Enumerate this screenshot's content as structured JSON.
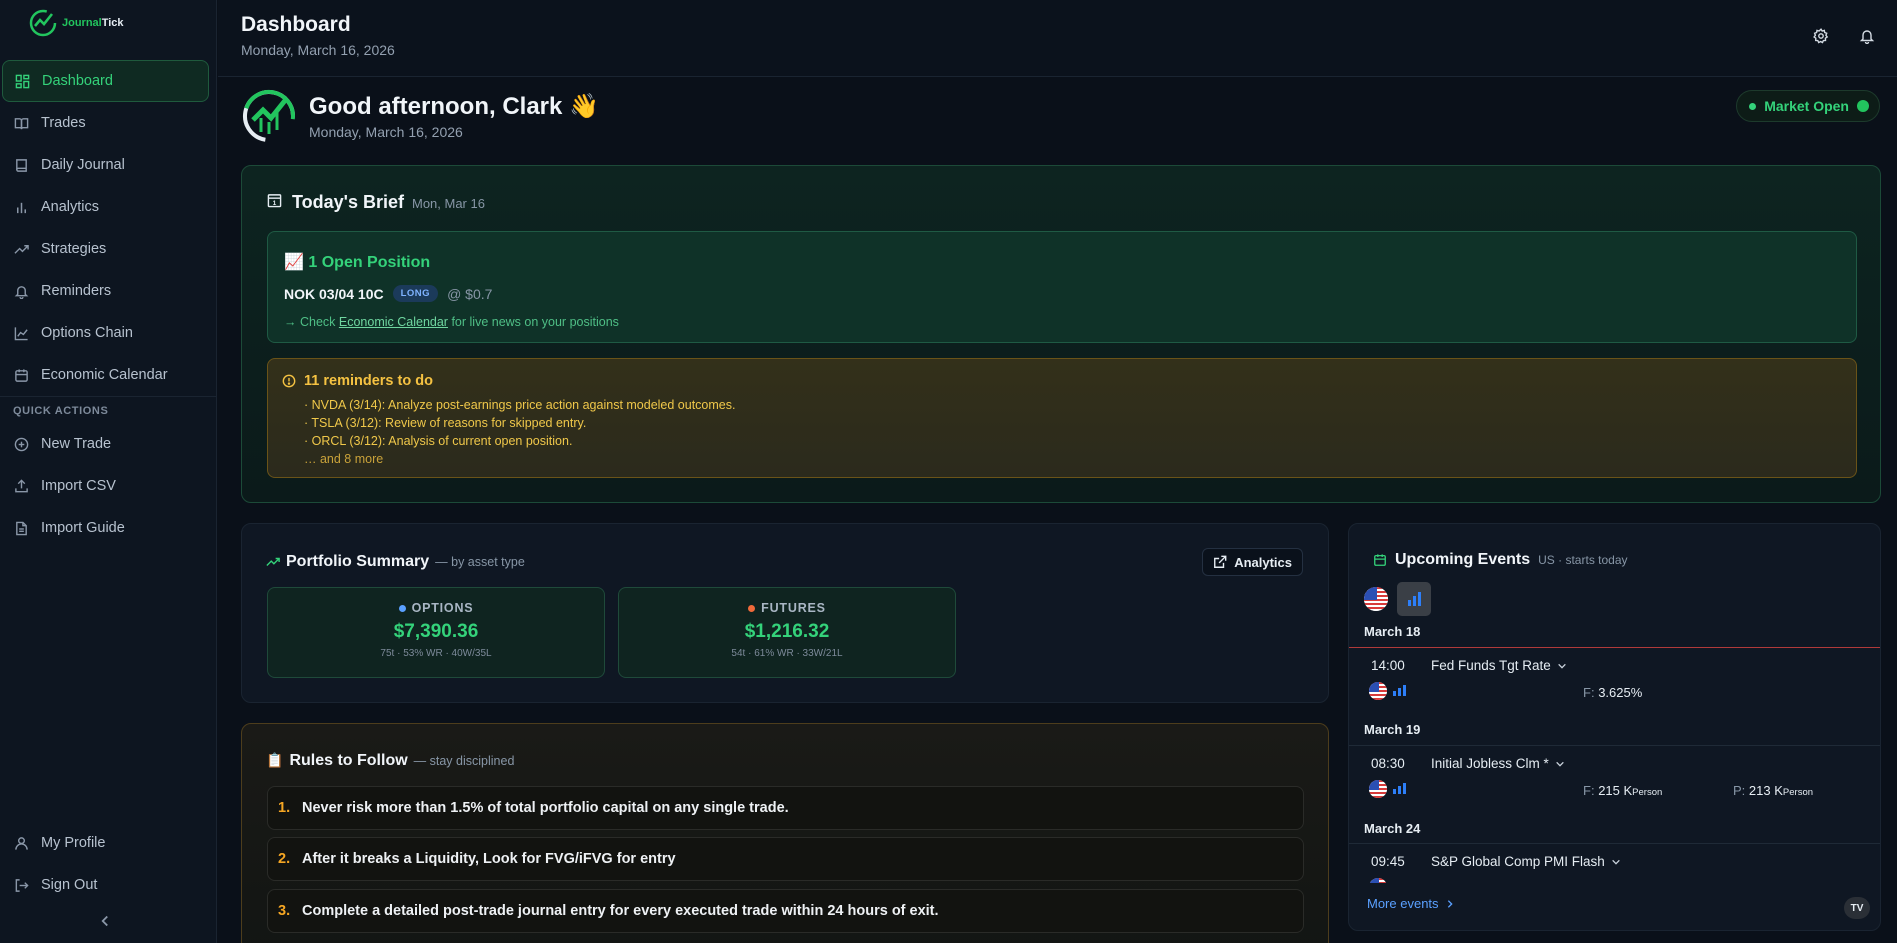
{
  "app": {
    "logo_prefix": "Journal",
    "logo_suffix": "Tick"
  },
  "sidebar": {
    "items": [
      {
        "label": "Dashboard",
        "icon": "dashboard-icon",
        "active": true
      },
      {
        "label": "Trades",
        "icon": "book-open-icon"
      },
      {
        "label": "Daily Journal",
        "icon": "book-icon"
      },
      {
        "label": "Analytics",
        "icon": "bar-chart-icon"
      },
      {
        "label": "Strategies",
        "icon": "trending-up-icon"
      },
      {
        "label": "Reminders",
        "icon": "bell-icon"
      },
      {
        "label": "Options Chain",
        "icon": "line-chart-icon"
      },
      {
        "label": "Economic Calendar",
        "icon": "calendar-icon"
      }
    ],
    "quick_actions_label": "QUICK ACTIONS",
    "quick_actions": [
      {
        "label": "New Trade",
        "icon": "plus-circle-icon"
      },
      {
        "label": "Import CSV",
        "icon": "upload-icon"
      },
      {
        "label": "Import Guide",
        "icon": "file-text-icon"
      }
    ],
    "bottom": [
      {
        "label": "My Profile",
        "icon": "user-icon"
      },
      {
        "label": "Sign Out",
        "icon": "sign-out-icon"
      }
    ]
  },
  "header": {
    "title": "Dashboard",
    "date": "Monday, March 16, 2026"
  },
  "greeting": {
    "title": "Good afternoon, Clark 👋",
    "date": "Monday, March 16, 2026",
    "market_status": "Market Open"
  },
  "brief": {
    "title": "Today's Brief",
    "date": "Mon, Mar 16",
    "open_positions": {
      "title": "1 Open Position",
      "symbol": "NOK 03/04 10C",
      "side": "LONG",
      "price": "@ $0.7",
      "hint_prefix": "→ Check ",
      "hint_link": "Economic Calendar",
      "hint_suffix": " for live news on your positions"
    },
    "reminders": {
      "title": "11 reminders to do",
      "items": [
        "· NVDA (3/14): Analyze post-earnings price action against modeled outcomes.",
        "· TSLA (3/12): Review of reasons for skipped entry.",
        "· ORCL (3/12): Analysis of current open position."
      ],
      "more": "… and 8 more"
    }
  },
  "portfolio": {
    "title": "Portfolio Summary",
    "subtitle": "— by asset type",
    "analytics_button": "Analytics",
    "assets": [
      {
        "label": "OPTIONS",
        "value": "$7,390.36",
        "stats": "75t · 53% WR · 40W/35L",
        "dot_color": "#5aa0ff"
      },
      {
        "label": "FUTURES",
        "value": "$1,216.32",
        "stats": "54t · 61% WR · 33W/21L",
        "dot_color": "#f06a3a"
      }
    ]
  },
  "rules": {
    "title": "Rules to Follow",
    "subtitle": "— stay disciplined",
    "items": [
      {
        "num": "1.",
        "text": "Never risk more than 1.5% of total portfolio capital on any single trade."
      },
      {
        "num": "2.",
        "text": "After it breaks a Liquidity, Look for FVG/iFVG for entry"
      },
      {
        "num": "3.",
        "text": "Complete a detailed post-trade journal entry for every executed trade within 24 hours of exit."
      }
    ]
  },
  "events": {
    "title": "Upcoming Events",
    "subtitle": "US · starts today",
    "groups": [
      {
        "date": "March 18",
        "time": "14:00",
        "name": "Fed Funds Tgt Rate",
        "forecast_label": "F:",
        "forecast": "3.625%",
        "prev_label": "",
        "prev": "",
        "unit": ""
      },
      {
        "date": "March 19",
        "time": "08:30",
        "name": "Initial Jobless Clm *",
        "forecast_label": "F:",
        "forecast": "215 K",
        "unit": "Person",
        "prev_label": "P:",
        "prev": "213 K",
        "prev_unit": "Person"
      },
      {
        "date": "March 24",
        "time": "09:45",
        "name": "S&P Global Comp PMI Flash"
      }
    ],
    "more": "More events",
    "tv_logo": "TV"
  },
  "colors": {
    "accent_green": "#34d27a",
    "warning_yellow": "#f5c242",
    "link_blue": "#5aa0ff"
  }
}
